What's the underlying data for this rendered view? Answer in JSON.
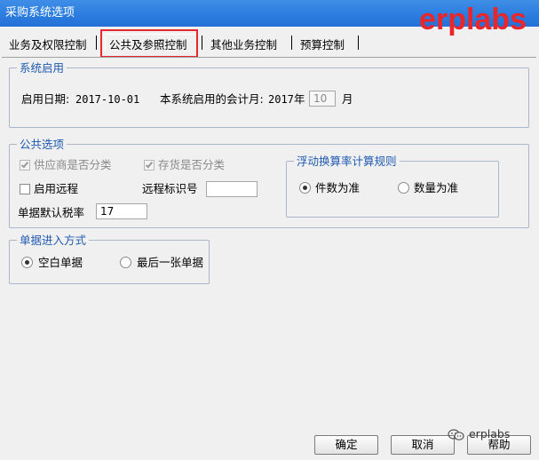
{
  "window": {
    "title": "采购系统选项"
  },
  "brand": {
    "text": "erplabs",
    "color": "#e8262b"
  },
  "tabs": [
    {
      "label": "业务及权限控制",
      "active": false
    },
    {
      "label": "公共及参照控制",
      "active": true
    },
    {
      "label": "其他业务控制",
      "active": false
    },
    {
      "label": "预算控制",
      "active": false
    }
  ],
  "system_enable": {
    "title": "系统启用",
    "enable_date_label": "启用日期:",
    "enable_date_value": "2017-10-01",
    "accounting_month_label": "本系统启用的会计月:",
    "year_value": "2017",
    "year_unit": "年",
    "month_value": "10",
    "month_unit": "月"
  },
  "public_options": {
    "title": "公共选项",
    "supplier_classify": {
      "label": "供应商是否分类",
      "checked": true,
      "disabled": true
    },
    "inventory_classify": {
      "label": "存货是否分类",
      "checked": true,
      "disabled": true
    },
    "enable_remote": {
      "label": "启用远程",
      "checked": false
    },
    "remote_id_label": "远程标识号",
    "remote_id_value": "",
    "default_tax_label": "单据默认税率",
    "default_tax_value": "17",
    "float_rule": {
      "title": "浮动换算率计算规则",
      "options": [
        {
          "label": "件数为准",
          "selected": true
        },
        {
          "label": "数量为准",
          "selected": false
        }
      ]
    }
  },
  "doc_entry": {
    "title": "单据进入方式",
    "options": [
      {
        "label": "空白单据",
        "selected": true
      },
      {
        "label": "最后一张单据",
        "selected": false
      }
    ]
  },
  "footer": {
    "confirm_label": "确定",
    "cancel_label": "取消",
    "help_label": "帮助",
    "wechat_text": "erplabs",
    "wechat_icon": "wechat-icon"
  },
  "colors": {
    "titlebar": "#2d7fe0",
    "group_title": "#1e5ab0",
    "highlight": "#e8262b"
  }
}
